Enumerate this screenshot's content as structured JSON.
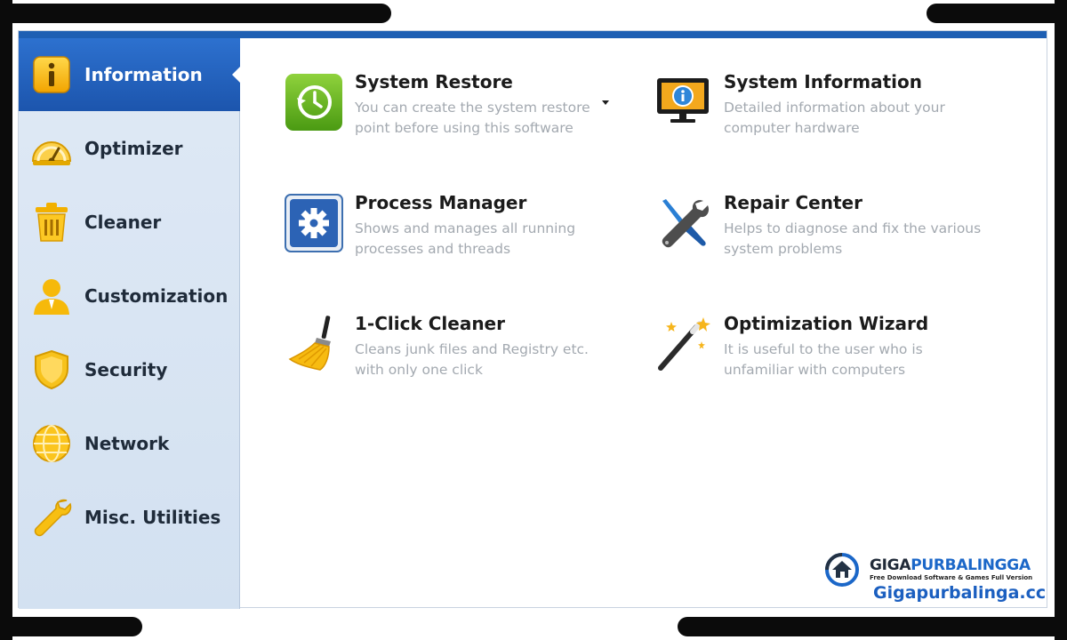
{
  "sidebar": {
    "items": [
      {
        "label": "Information",
        "icon": "information-icon",
        "active": true
      },
      {
        "label": "Optimizer",
        "icon": "gauge-icon",
        "active": false
      },
      {
        "label": "Cleaner",
        "icon": "trash-bin-icon",
        "active": false
      },
      {
        "label": "Customization",
        "icon": "user-icon",
        "active": false
      },
      {
        "label": "Security",
        "icon": "shield-icon",
        "active": false
      },
      {
        "label": "Network",
        "icon": "globe-icon",
        "active": false
      },
      {
        "label": "Misc. Utilities",
        "icon": "wrench-icon",
        "active": false
      }
    ]
  },
  "tools": [
    {
      "title": "System Restore",
      "description": "You can create the system restore point before using this software",
      "icon": "clock-restore-icon"
    },
    {
      "title": "System Information",
      "description": "Detailed information about your computer hardware",
      "icon": "monitor-info-icon"
    },
    {
      "title": "Process Manager",
      "description": "Shows and manages all running processes and threads",
      "icon": "gear-icon"
    },
    {
      "title": "Repair Center",
      "description": "Helps to diagnose and fix the various system problems",
      "icon": "wrench-screwdriver-icon"
    },
    {
      "title": "1-Click Cleaner",
      "description": "Cleans junk files and Registry etc. with only one click",
      "icon": "broom-icon"
    },
    {
      "title": "Optimization Wizard",
      "description": "It is useful to the user who is unfamiliar with computers",
      "icon": "magic-wand-icon"
    }
  ],
  "watermark": {
    "brand_part1": "GIGA",
    "brand_part2": "PURBALINGGA",
    "tagline": "Free Download Software & Games Full Version",
    "url": "Gigapurbalinga.cc"
  },
  "colors": {
    "accent": "#1e5fb3",
    "active_nav": "#2d71cf",
    "sidebar_bg": "#dfe9f5",
    "description_text": "#a3a9b0"
  }
}
